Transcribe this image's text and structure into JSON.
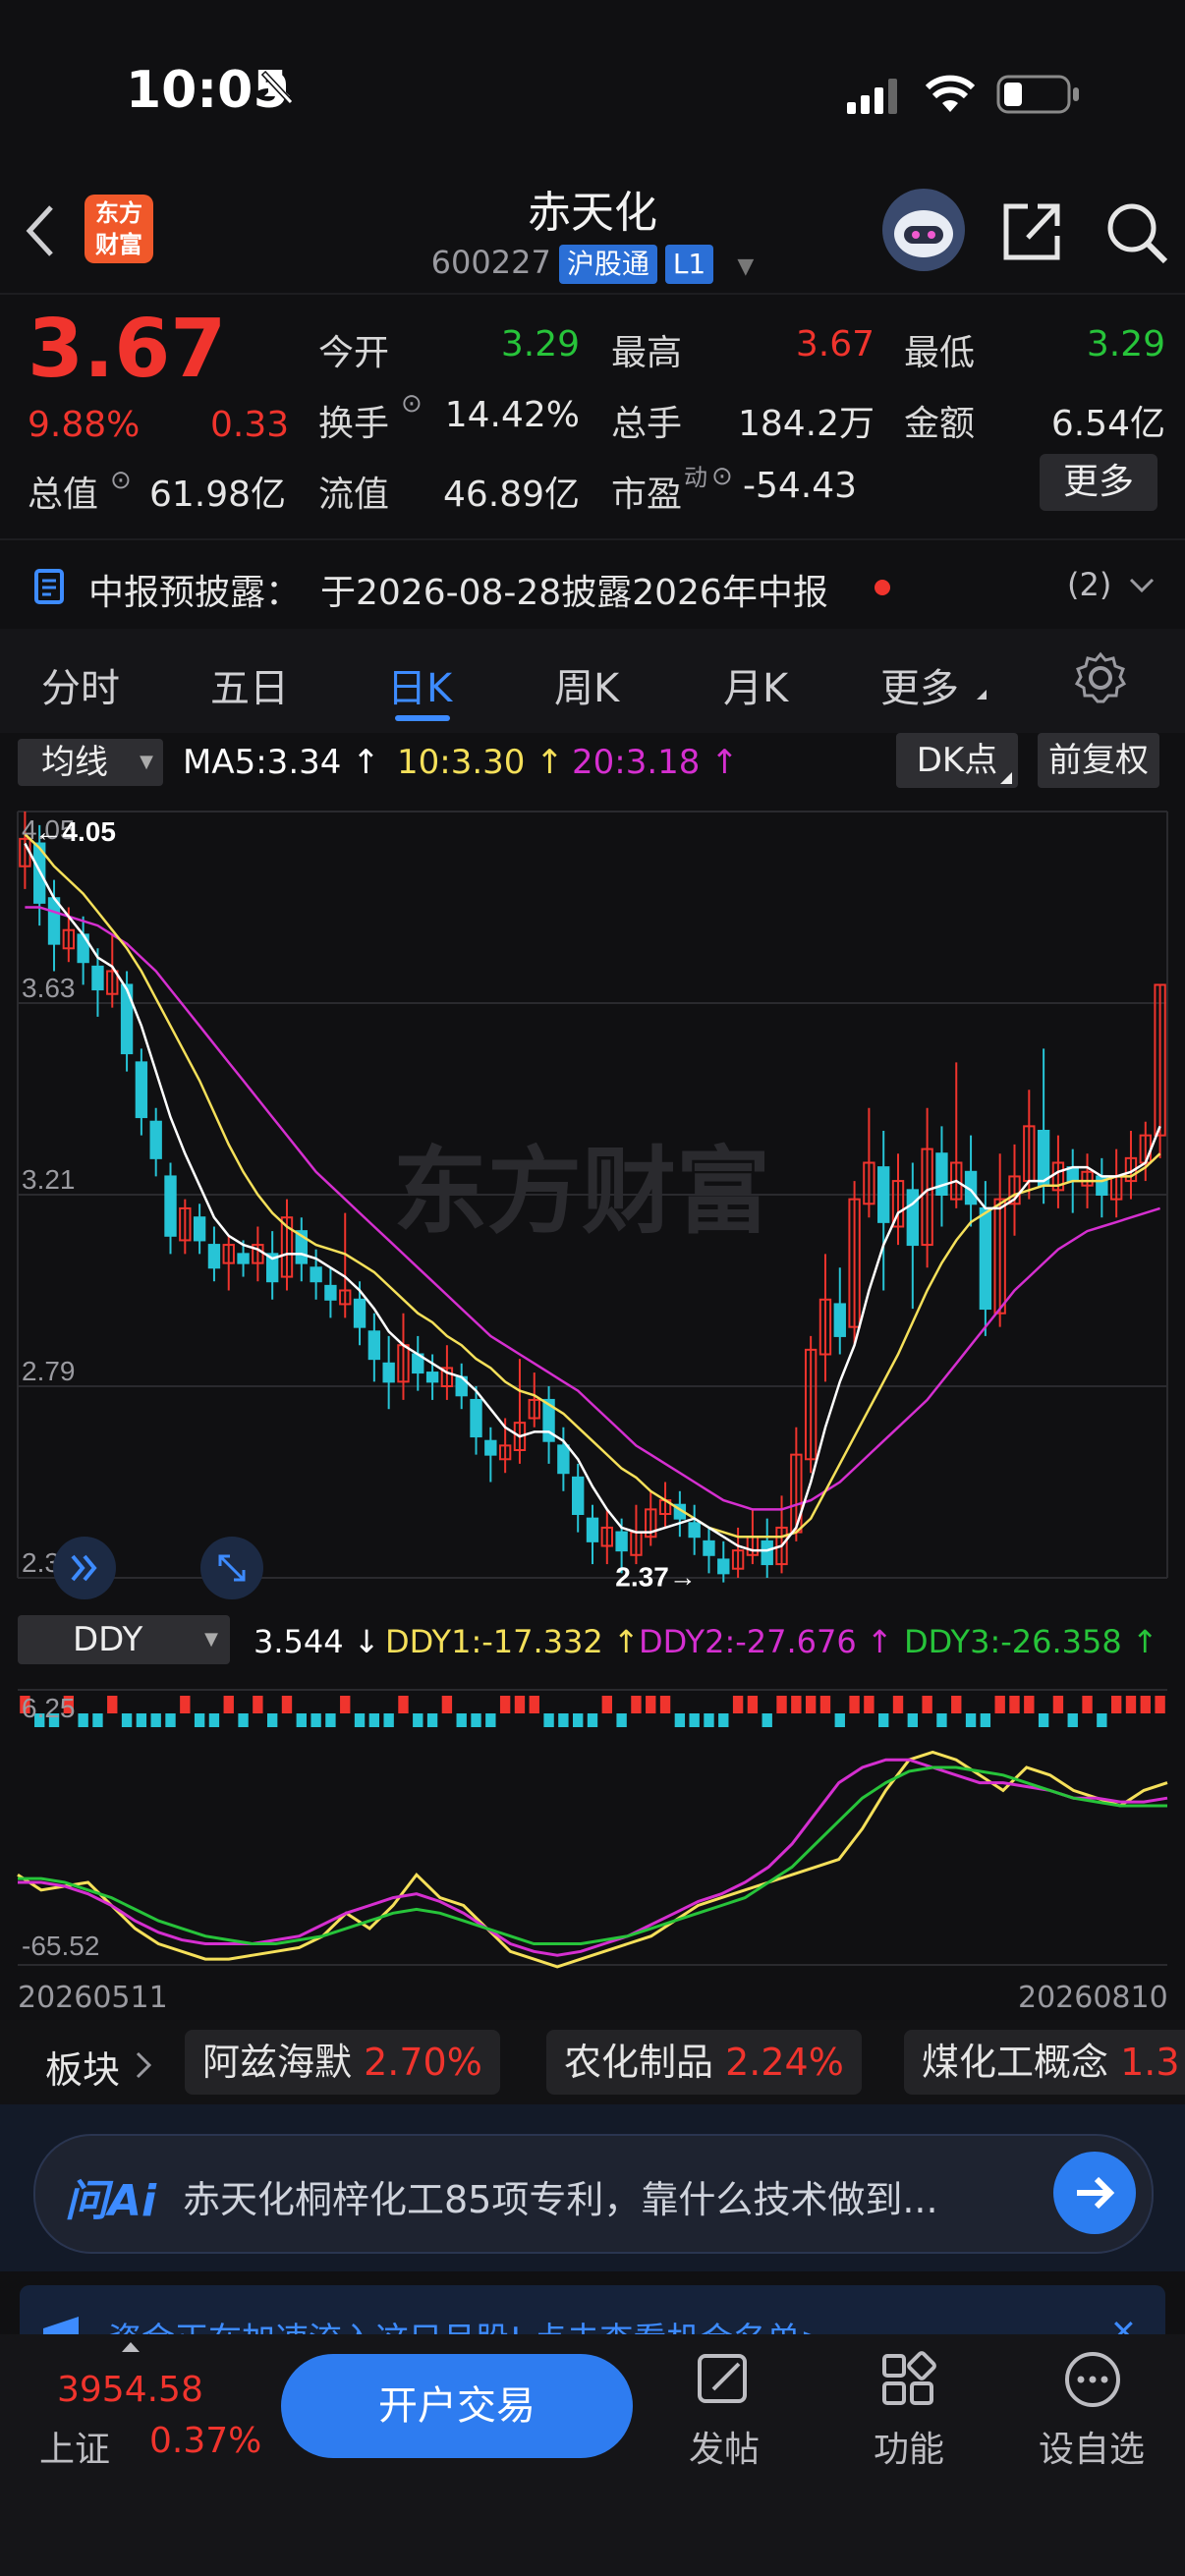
{
  "status_bar": {
    "time": "10:05"
  },
  "header": {
    "logo_text": [
      "东方",
      "财富"
    ],
    "title": "赤天化",
    "code": "600227",
    "tag1": "沪股通",
    "tag2": "L1"
  },
  "quote": {
    "price": "3.67",
    "change_pct": "9.88%",
    "change": "0.33",
    "total_value_label": "总值",
    "total_value": "61.98亿",
    "open_label": "今开",
    "open": "3.29",
    "high_label": "最高",
    "high": "3.67",
    "low_label": "最低",
    "low": "3.29",
    "turnover_label": "换手",
    "turnover": "14.42%",
    "volume_label": "总手",
    "volume": "184.2万",
    "amount_label": "金额",
    "amount": "6.54亿",
    "float_label": "流值",
    "float_value": "46.89亿",
    "pe_label": "市盈",
    "pe_sup": "动",
    "pe": "-54.43",
    "more": "更多"
  },
  "notice": {
    "label": "中报预披露：",
    "text": "于2026-08-28披露2026年中报",
    "count": "(2)"
  },
  "tabs": {
    "items": [
      "分时",
      "五日",
      "日K",
      "周K",
      "月K",
      "更多"
    ],
    "active_index": 2
  },
  "ma_bar": {
    "select": "均线",
    "ma5": "MA5:3.34",
    "ma10": "10:3.30",
    "ma20": "20:3.18",
    "dk": "DK点",
    "adjust": "前复权"
  },
  "watermark": "东方财富",
  "ddy_bar": {
    "select": "DDY",
    "ddy": "3.544",
    "ddy1": "DDY1:-17.332",
    "ddy2": "DDY2:-27.676",
    "ddy3": "DDY3:-26.358"
  },
  "dates": {
    "start": "20260511",
    "end": "20260810"
  },
  "sectors": {
    "label": "板块",
    "items": [
      {
        "name": "阿兹海默",
        "pct": "2.70%"
      },
      {
        "name": "农化制品",
        "pct": "2.24%"
      },
      {
        "name": "煤化工概念",
        "pct": "1.3"
      }
    ]
  },
  "ai_bar": {
    "logo": "问Ai",
    "text": "赤天化桐梓化工85项专利，靠什么技术做到..."
  },
  "banner": {
    "text": "资金正在加速流入这只月股! 点击查看机会名单>"
  },
  "bottom_nav": {
    "index_value": "3954.58",
    "index_name": "上证",
    "index_pct": "0.37%",
    "trade": "开户交易",
    "post": "发帖",
    "functions": "功能",
    "watchlist": "设自选"
  },
  "colors": {
    "up": "#f0342d",
    "down": "#27c4d6",
    "accent": "#3d8bff",
    "ma5": "#ffffff",
    "ma10": "#f5e05a",
    "ma20": "#d52fd0",
    "ddy_green": "#27c43a"
  },
  "chart_data": [
    {
      "type": "candlestick",
      "y_ticks": [
        "4.05",
        "3.63",
        "3.21",
        "2.79",
        "2.37"
      ],
      "ylim": [
        2.37,
        4.05
      ],
      "max_label": "4.05",
      "min_label": "2.37",
      "x_start": "20260511",
      "x_end": "20260810",
      "candles": [
        [
          3.93,
          3.99,
          4.05,
          3.88
        ],
        [
          3.98,
          3.85,
          4.02,
          3.8
        ],
        [
          3.86,
          3.76,
          3.9,
          3.7
        ],
        [
          3.75,
          3.79,
          3.84,
          3.72
        ],
        [
          3.78,
          3.72,
          3.82,
          3.67
        ],
        [
          3.71,
          3.66,
          3.75,
          3.6
        ],
        [
          3.65,
          3.7,
          3.78,
          3.62
        ],
        [
          3.67,
          3.52,
          3.7,
          3.48
        ],
        [
          3.5,
          3.38,
          3.53,
          3.34
        ],
        [
          3.37,
          3.29,
          3.4,
          3.25
        ],
        [
          3.25,
          3.12,
          3.28,
          3.08
        ],
        [
          3.11,
          3.18,
          3.2,
          3.08
        ],
        [
          3.16,
          3.11,
          3.19,
          3.08
        ],
        [
          3.1,
          3.05,
          3.14,
          3.02
        ],
        [
          3.06,
          3.1,
          3.12,
          3.0
        ],
        [
          3.08,
          3.06,
          3.11,
          3.03
        ],
        [
          3.06,
          3.1,
          3.14,
          3.02
        ],
        [
          3.08,
          3.02,
          3.13,
          2.98
        ],
        [
          3.03,
          3.16,
          3.2,
          3.0
        ],
        [
          3.13,
          3.06,
          3.16,
          3.02
        ],
        [
          3.05,
          3.02,
          3.09,
          2.98
        ],
        [
          3.01,
          2.98,
          3.05,
          2.94
        ],
        [
          2.97,
          3.0,
          3.17,
          2.94
        ],
        [
          2.98,
          2.92,
          3.02,
          2.88
        ],
        [
          2.91,
          2.85,
          2.95,
          2.8
        ],
        [
          2.84,
          2.8,
          2.9,
          2.74
        ],
        [
          2.8,
          2.88,
          2.95,
          2.76
        ],
        [
          2.86,
          2.82,
          2.9,
          2.78
        ],
        [
          2.82,
          2.8,
          2.86,
          2.76
        ],
        [
          2.79,
          2.83,
          2.88,
          2.76
        ],
        [
          2.81,
          2.77,
          2.84,
          2.74
        ],
        [
          2.76,
          2.68,
          2.79,
          2.64
        ],
        [
          2.67,
          2.64,
          2.7,
          2.58
        ],
        [
          2.63,
          2.66,
          2.72,
          2.6
        ],
        [
          2.65,
          2.71,
          2.85,
          2.62
        ],
        [
          2.72,
          2.76,
          2.82,
          2.7
        ],
        [
          2.76,
          2.67,
          2.79,
          2.62
        ],
        [
          2.66,
          2.6,
          2.7,
          2.56
        ],
        [
          2.59,
          2.51,
          2.62,
          2.47
        ],
        [
          2.5,
          2.45,
          2.53,
          2.4
        ],
        [
          2.44,
          2.48,
          2.52,
          2.4
        ],
        [
          2.47,
          2.43,
          2.5,
          2.38
        ],
        [
          2.42,
          2.47,
          2.53,
          2.4
        ],
        [
          2.46,
          2.52,
          2.56,
          2.44
        ],
        [
          2.51,
          2.54,
          2.58,
          2.48
        ],
        [
          2.53,
          2.5,
          2.56,
          2.46
        ],
        [
          2.49,
          2.46,
          2.53,
          2.42
        ],
        [
          2.45,
          2.42,
          2.48,
          2.38
        ],
        [
          2.41,
          2.38,
          2.45,
          2.36
        ],
        [
          2.39,
          2.43,
          2.48,
          2.37
        ],
        [
          2.42,
          2.46,
          2.52,
          2.4
        ],
        [
          2.45,
          2.4,
          2.5,
          2.37
        ],
        [
          2.4,
          2.48,
          2.55,
          2.38
        ],
        [
          2.47,
          2.64,
          2.7,
          2.45
        ],
        [
          2.63,
          2.87,
          2.9,
          2.6
        ],
        [
          2.86,
          2.98,
          3.08,
          2.8
        ],
        [
          2.97,
          2.9,
          3.05,
          2.86
        ],
        [
          2.92,
          3.2,
          3.24,
          2.88
        ],
        [
          3.19,
          3.28,
          3.4,
          3.16
        ],
        [
          3.27,
          3.15,
          3.35,
          3.0
        ],
        [
          3.14,
          3.24,
          3.3,
          3.1
        ],
        [
          3.22,
          3.1,
          3.28,
          2.96
        ],
        [
          3.1,
          3.31,
          3.4,
          3.05
        ],
        [
          3.3,
          3.21,
          3.36,
          3.14
        ],
        [
          3.2,
          3.28,
          3.5,
          3.18
        ],
        [
          3.26,
          3.19,
          3.34,
          3.14
        ],
        [
          3.18,
          2.96,
          3.24,
          2.9
        ],
        [
          2.95,
          3.2,
          3.3,
          2.92
        ],
        [
          3.19,
          3.25,
          3.32,
          3.12
        ],
        [
          3.24,
          3.36,
          3.44,
          3.2
        ],
        [
          3.35,
          3.23,
          3.53,
          3.19
        ],
        [
          3.22,
          3.28,
          3.34,
          3.18
        ],
        [
          3.27,
          3.24,
          3.31,
          3.17
        ],
        [
          3.23,
          3.26,
          3.3,
          3.18
        ],
        [
          3.25,
          3.21,
          3.29,
          3.16
        ],
        [
          3.2,
          3.25,
          3.31,
          3.16
        ],
        [
          3.24,
          3.29,
          3.35,
          3.2
        ],
        [
          3.28,
          3.34,
          3.37,
          3.24
        ],
        [
          3.34,
          3.67,
          3.67,
          3.29
        ]
      ],
      "ma5": [
        3.98,
        3.92,
        3.86,
        3.82,
        3.78,
        3.73,
        3.71,
        3.66,
        3.58,
        3.48,
        3.38,
        3.3,
        3.23,
        3.16,
        3.12,
        3.1,
        3.09,
        3.07,
        3.08,
        3.08,
        3.07,
        3.05,
        3.03,
        3.0,
        2.96,
        2.91,
        2.88,
        2.86,
        2.84,
        2.82,
        2.81,
        2.78,
        2.74,
        2.7,
        2.68,
        2.69,
        2.69,
        2.67,
        2.63,
        2.57,
        2.52,
        2.48,
        2.47,
        2.47,
        2.48,
        2.49,
        2.5,
        2.48,
        2.46,
        2.44,
        2.43,
        2.43,
        2.44,
        2.48,
        2.58,
        2.7,
        2.8,
        2.88,
        3.0,
        3.1,
        3.17,
        3.19,
        3.22,
        3.23,
        3.24,
        3.22,
        3.18,
        3.18,
        3.2,
        3.24,
        3.24,
        3.26,
        3.27,
        3.27,
        3.25,
        3.25,
        3.26,
        3.28,
        3.36
      ],
      "ma10": [
        4.0,
        3.97,
        3.93,
        3.9,
        3.87,
        3.83,
        3.79,
        3.75,
        3.7,
        3.64,
        3.58,
        3.52,
        3.46,
        3.39,
        3.32,
        3.26,
        3.21,
        3.17,
        3.14,
        3.12,
        3.1,
        3.09,
        3.08,
        3.06,
        3.04,
        3.01,
        2.98,
        2.95,
        2.93,
        2.9,
        2.88,
        2.85,
        2.83,
        2.8,
        2.78,
        2.77,
        2.75,
        2.73,
        2.7,
        2.67,
        2.64,
        2.61,
        2.59,
        2.56,
        2.54,
        2.52,
        2.5,
        2.48,
        2.47,
        2.46,
        2.46,
        2.46,
        2.46,
        2.47,
        2.5,
        2.56,
        2.62,
        2.68,
        2.74,
        2.8,
        2.86,
        2.93,
        3.0,
        3.06,
        3.11,
        3.15,
        3.17,
        3.19,
        3.21,
        3.22,
        3.23,
        3.23,
        3.24,
        3.24,
        3.24,
        3.25,
        3.25,
        3.27,
        3.3
      ],
      "ma20": [
        3.84,
        3.84,
        3.83,
        3.82,
        3.81,
        3.8,
        3.78,
        3.76,
        3.73,
        3.7,
        3.66,
        3.62,
        3.58,
        3.54,
        3.5,
        3.46,
        3.42,
        3.38,
        3.34,
        3.3,
        3.26,
        3.23,
        3.2,
        3.17,
        3.14,
        3.11,
        3.08,
        3.05,
        3.02,
        2.99,
        2.96,
        2.93,
        2.9,
        2.88,
        2.86,
        2.84,
        2.82,
        2.8,
        2.78,
        2.75,
        2.72,
        2.69,
        2.66,
        2.64,
        2.62,
        2.6,
        2.58,
        2.56,
        2.54,
        2.53,
        2.52,
        2.52,
        2.52,
        2.53,
        2.54,
        2.56,
        2.58,
        2.61,
        2.64,
        2.67,
        2.7,
        2.73,
        2.76,
        2.8,
        2.84,
        2.88,
        2.92,
        2.96,
        3.0,
        3.03,
        3.06,
        3.09,
        3.11,
        3.13,
        3.14,
        3.15,
        3.16,
        3.17,
        3.18
      ]
    },
    {
      "type": "line",
      "y_ticks": [
        "6.25",
        "-65.52"
      ],
      "ylim": [
        -65.52,
        6.25
      ],
      "series": [
        {
          "name": "DDY1",
          "color": "#f5e05a",
          "values": [
            -42,
            -46,
            -45,
            -44,
            -50,
            -56,
            -60,
            -62,
            -64,
            -64,
            -63,
            -62,
            -61,
            -58,
            -52,
            -56,
            -50,
            -42,
            -48,
            -50,
            -56,
            -62,
            -64,
            -66,
            -64,
            -62,
            -60,
            -58,
            -54,
            -50,
            -48,
            -46,
            -44,
            -42,
            -40,
            -38,
            -30,
            -20,
            -12,
            -10,
            -12,
            -16,
            -20,
            -14,
            -16,
            -20,
            -22,
            -24,
            -20,
            -18
          ]
        },
        {
          "name": "DDY2",
          "color": "#d52fd0",
          "values": [
            -44,
            -44,
            -45,
            -47,
            -50,
            -54,
            -57,
            -59,
            -60,
            -60,
            -60,
            -59,
            -58,
            -55,
            -52,
            -50,
            -48,
            -47,
            -49,
            -52,
            -56,
            -60,
            -62,
            -63,
            -62,
            -60,
            -58,
            -55,
            -52,
            -49,
            -47,
            -44,
            -40,
            -34,
            -26,
            -18,
            -14,
            -12,
            -12,
            -14,
            -16,
            -18,
            -18,
            -19,
            -20,
            -22,
            -22,
            -23,
            -23,
            -22
          ]
        },
        {
          "name": "DDY3",
          "color": "#27c43a",
          "values": [
            -43,
            -43,
            -44,
            -46,
            -48,
            -51,
            -54,
            -56,
            -58,
            -59,
            -60,
            -60,
            -59,
            -58,
            -56,
            -54,
            -52,
            -51,
            -52,
            -54,
            -56,
            -58,
            -60,
            -60,
            -60,
            -59,
            -58,
            -56,
            -54,
            -52,
            -50,
            -48,
            -44,
            -40,
            -34,
            -28,
            -22,
            -18,
            -15,
            -14,
            -14,
            -15,
            -16,
            -18,
            -20,
            -22,
            -23,
            -24,
            -24,
            -24
          ]
        }
      ]
    }
  ]
}
